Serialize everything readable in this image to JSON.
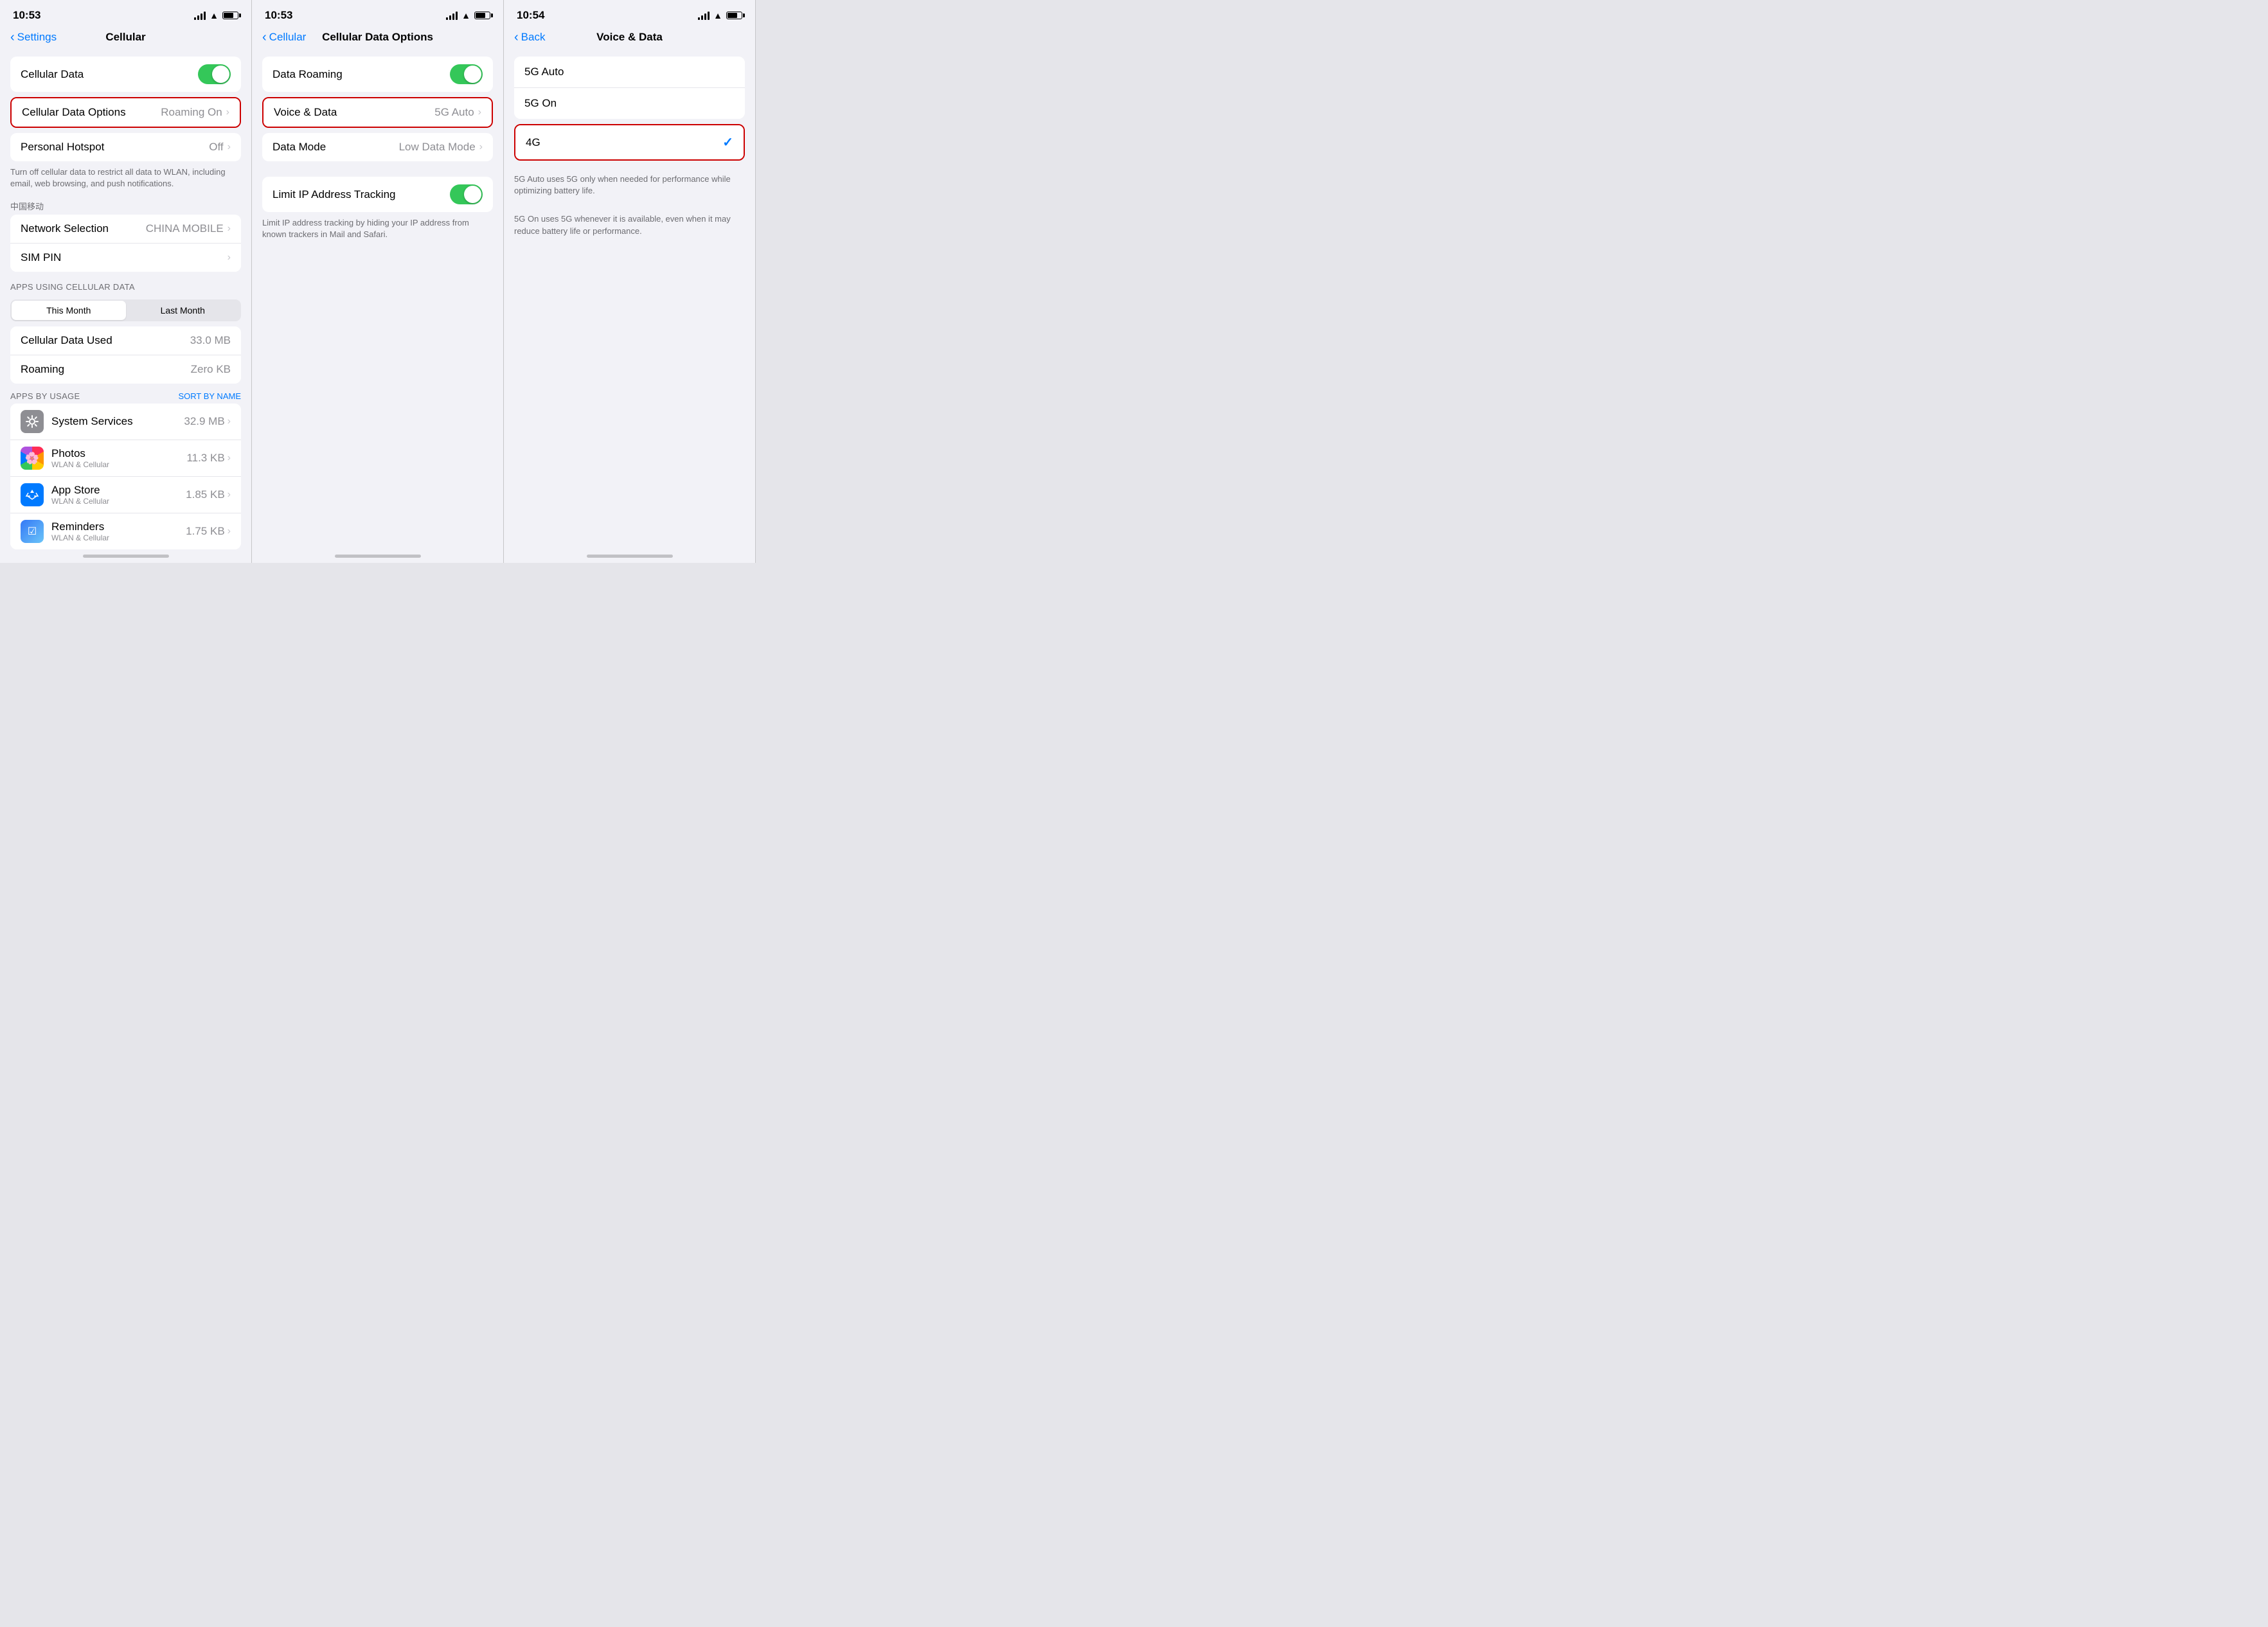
{
  "screen1": {
    "time": "10:53",
    "nav_back": "Settings",
    "nav_title": "Cellular",
    "rows": [
      {
        "label": "Cellular Data",
        "value": "",
        "type": "toggle",
        "on": true
      },
      {
        "label": "Cellular Data Options",
        "value": "Roaming On",
        "type": "nav",
        "highlighted": true
      },
      {
        "label": "Personal Hotspot",
        "value": "Off",
        "type": "nav",
        "highlighted": false
      }
    ],
    "description": "Turn off cellular data to restrict all data to WLAN, including email, web browsing, and push notifications.",
    "carrier_label": "中国移动",
    "carrier_rows": [
      {
        "label": "Network Selection",
        "value": "CHINA MOBILE",
        "type": "nav"
      },
      {
        "label": "SIM PIN",
        "value": "",
        "type": "nav"
      }
    ],
    "apps_label": "APPS USING CELLULAR DATA",
    "segment": {
      "options": [
        "This Month",
        "Last Month"
      ],
      "active": 0
    },
    "stats": [
      {
        "label": "Cellular Data Used",
        "value": "33.0 MB"
      },
      {
        "label": "Roaming",
        "value": "Zero KB"
      }
    ],
    "apps_by_usage": "APPS BY USAGE",
    "sort_label": "SORT BY NAME",
    "apps": [
      {
        "name": "System Services",
        "subtitle": "",
        "size": "32.9 MB",
        "icon_type": "gear"
      },
      {
        "name": "Photos",
        "subtitle": "WLAN & Cellular",
        "size": "11.3 KB",
        "icon_type": "photos"
      },
      {
        "name": "App Store",
        "subtitle": "WLAN & Cellular",
        "size": "1.85 KB",
        "icon_type": "appstore"
      },
      {
        "name": "Reminders",
        "subtitle": "WLAN & Cellular",
        "size": "1.75 KB",
        "icon_type": "reminders"
      }
    ]
  },
  "screen2": {
    "time": "10:53",
    "nav_back": "Cellular",
    "nav_title": "Cellular Data Options",
    "rows": [
      {
        "label": "Data Roaming",
        "value": "",
        "type": "toggle",
        "on": true
      },
      {
        "label": "Voice & Data",
        "value": "5G Auto",
        "type": "nav",
        "highlighted": true
      },
      {
        "label": "Data Mode",
        "value": "Low Data Mode",
        "type": "nav",
        "highlighted": false
      }
    ],
    "limit_ip": {
      "label": "Limit IP Address Tracking",
      "toggle_on": true,
      "description": "Limit IP address tracking by hiding your IP address from known trackers in Mail and Safari."
    }
  },
  "screen3": {
    "time": "10:54",
    "nav_back": "Back",
    "nav_title": "Voice & Data",
    "options": [
      {
        "label": "5G Auto",
        "selected": false
      },
      {
        "label": "5G On",
        "selected": false
      },
      {
        "label": "4G",
        "selected": true
      }
    ],
    "notes": [
      "5G Auto uses 5G only when needed for performance while optimizing battery life.",
      "5G On uses 5G whenever it is available, even when it may reduce battery life or performance."
    ]
  },
  "colors": {
    "green": "#34c759",
    "blue": "#007aff",
    "red": "#cc0000",
    "separator": "#e5e5ea",
    "bg": "#f2f2f7"
  }
}
